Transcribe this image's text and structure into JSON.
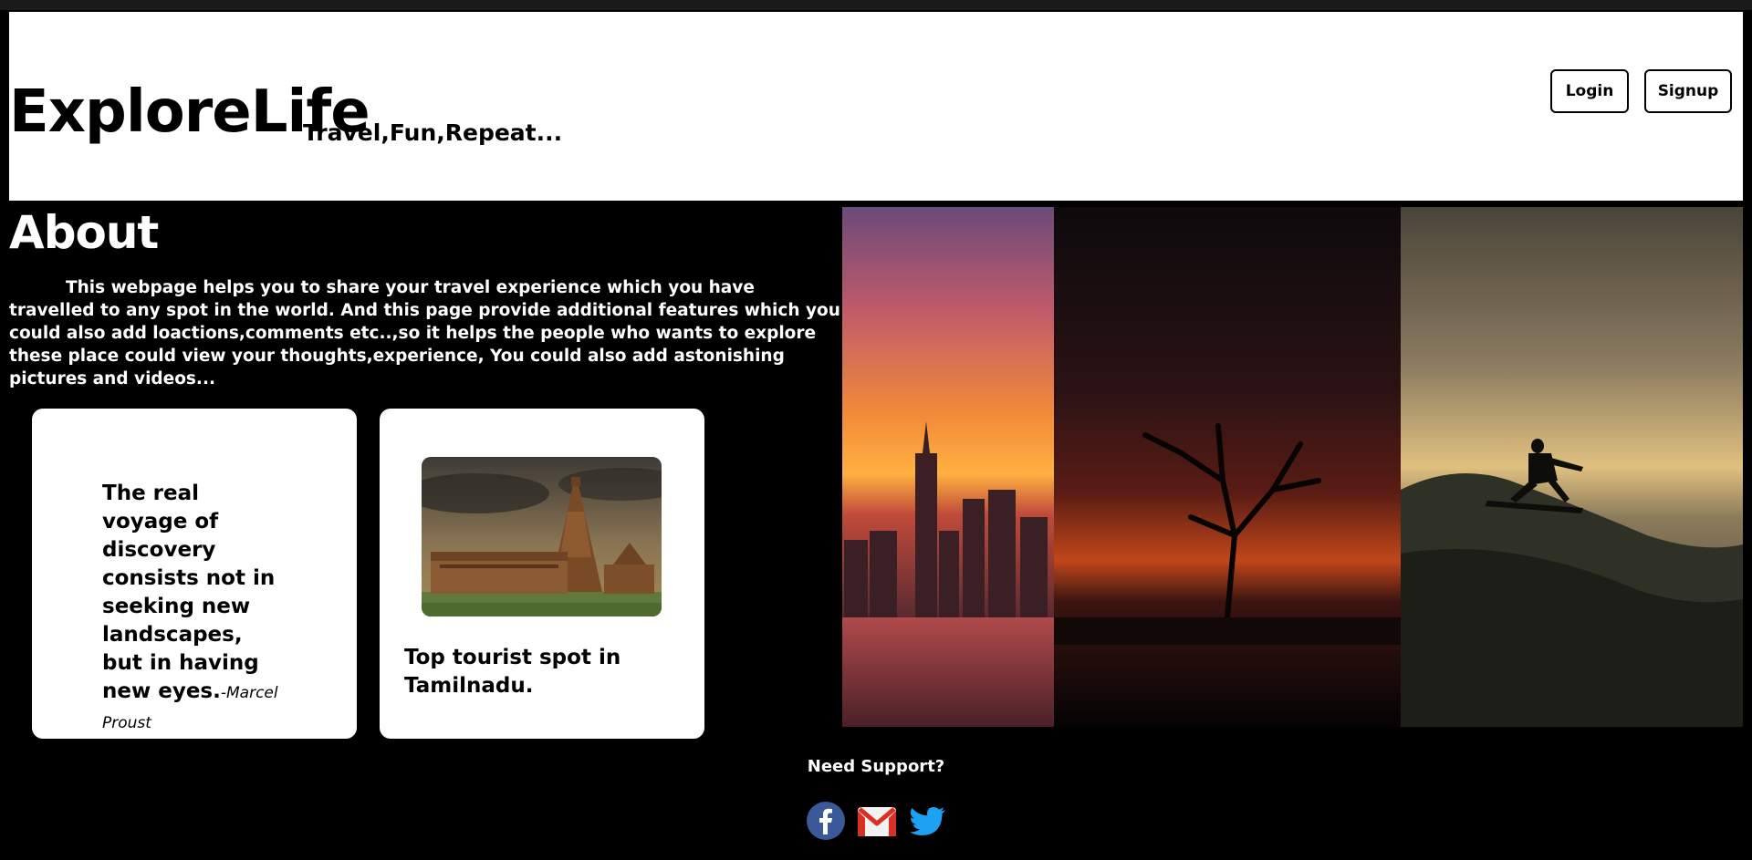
{
  "header": {
    "brand": "ExploreLife",
    "tagline": "Travel,Fun,Repeat...",
    "login_label": "Login",
    "signup_label": "Signup"
  },
  "about": {
    "title": "About",
    "text": "This webpage helps you to share your travel experience which you have travelled to any spot in the world. And this page provide additional features which you could also add loactions,comments etc..,so it helps the people who wants to explore these place could view your thoughts,experience, You could also add astonishing pictures and videos..."
  },
  "cards": {
    "quote": "The real voyage of discovery consists not in seeking new landscapes, but in having new eyes.",
    "quote_author": "-Marcel Proust",
    "caption": "Top tourist spot in Tamilnadu."
  },
  "footer": {
    "support_label": "Need Support?",
    "socials": [
      "facebook-icon",
      "gmail-icon",
      "twitter-icon"
    ]
  },
  "colors": {
    "background": "#000000",
    "surface": "#ffffff",
    "facebook": "#3b5998",
    "gmail": "#d93025",
    "twitter": "#1da1f2"
  }
}
